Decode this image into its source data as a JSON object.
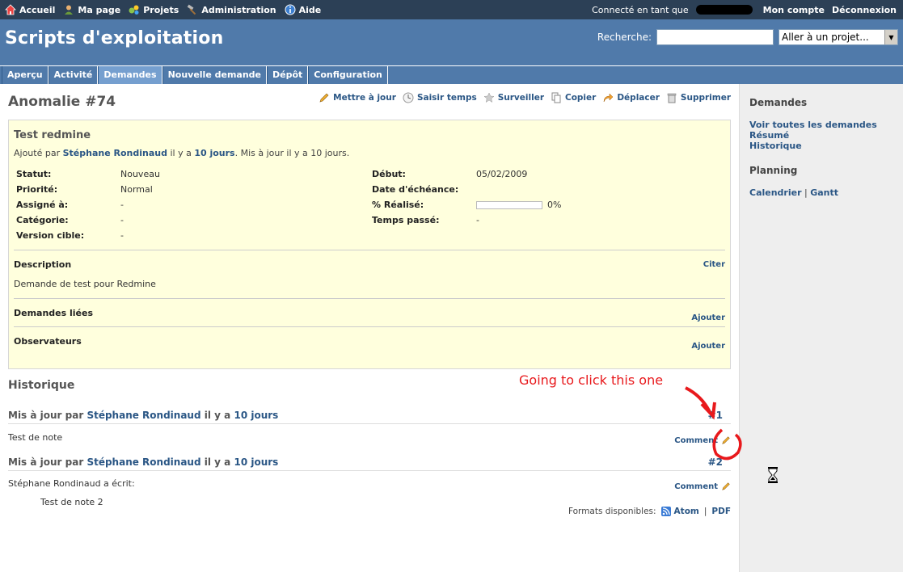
{
  "top_menu": {
    "items": [
      {
        "label": "Accueil",
        "icon": "home-icon"
      },
      {
        "label": "Ma page",
        "icon": "user-icon"
      },
      {
        "label": "Projets",
        "icon": "projects-icon"
      },
      {
        "label": "Administration",
        "icon": "hammer-icon"
      },
      {
        "label": "Aide",
        "icon": "help-icon"
      }
    ],
    "logged_as": "Connecté en tant que",
    "my_account": "Mon compte",
    "logout": "Déconnexion"
  },
  "header": {
    "project_title": "Scripts d'exploitation",
    "search_label": "Recherche:",
    "search_value": "",
    "jump_select": "Aller à un projet..."
  },
  "tabs": [
    "Aperçu",
    "Activité",
    "Demandes",
    "Nouvelle demande",
    "Dépôt",
    "Configuration"
  ],
  "selected_tab": "Demandes",
  "issue": {
    "heading": "Anomalie #74",
    "actions": [
      {
        "label": "Mettre à jour",
        "icon": "pencil-icon"
      },
      {
        "label": "Saisir temps",
        "icon": "clock-icon"
      },
      {
        "label": "Surveiller",
        "icon": "star-icon"
      },
      {
        "label": "Copier",
        "icon": "copy-icon"
      },
      {
        "label": "Déplacer",
        "icon": "move-icon"
      },
      {
        "label": "Supprimer",
        "icon": "trash-icon"
      }
    ],
    "subject": "Test redmine",
    "added_by": "Ajouté par",
    "author": "Stéphane Rondinaud",
    "il_y_a": "il y a",
    "age": "10 jours",
    "updated_suffix": ". Mis à jour il y a 10 jours.",
    "attributes_left": [
      {
        "label": "Statut:",
        "value": "Nouveau"
      },
      {
        "label": "Priorité:",
        "value": "Normal"
      },
      {
        "label": "Assigné à:",
        "value": "-"
      },
      {
        "label": "Catégorie:",
        "value": "-"
      },
      {
        "label": "Version cible:",
        "value": "-"
      }
    ],
    "attributes_right": {
      "start_label": "Début:",
      "start_value": "05/02/2009",
      "due_label": "Date d'échéance:",
      "due_value": "",
      "done_label": "% Réalisé:",
      "done_value": "0%",
      "done_ratio": 0,
      "spent_label": "Temps passé:",
      "spent_value": "-"
    },
    "description_label": "Description",
    "quote_label": "Citer",
    "description_text": "Demande de test pour Redmine",
    "related_label": "Demandes liées",
    "watchers_label": "Observateurs",
    "add_label": "Ajouter"
  },
  "history": {
    "title": "Historique",
    "updated_by": "Mis à jour par",
    "comment_label": "Comment",
    "journals": [
      {
        "author": "Stéphane Rondinaud",
        "age": "10 jours",
        "number": "#1",
        "note_line": "Test de note",
        "quote_line": ""
      },
      {
        "author": "Stéphane Rondinaud",
        "age": "10 jours",
        "number": "#2",
        "note_line": "Stéphane Rondinaud a écrit:",
        "quote_line": "Test de note 2"
      }
    ]
  },
  "formats": {
    "label": "Formats disponibles:",
    "atom": "Atom",
    "pdf": "PDF"
  },
  "sidebar": {
    "issues_title": "Demandes",
    "issue_links": [
      "Voir toutes les demandes",
      "Résumé",
      "Historique"
    ],
    "planning_title": "Planning",
    "calendar": "Calendrier",
    "gantt": "Gantt"
  },
  "annotation": {
    "text": "Going to click this one",
    "color": "#e8191c"
  },
  "colors": {
    "top_bar": "#2c4056",
    "header": "#507aaa",
    "tab_selected": "#759fcf",
    "issue_bg": "#ffffdd",
    "sidebar_bg": "#eeeeee",
    "link": "#2a5685"
  }
}
